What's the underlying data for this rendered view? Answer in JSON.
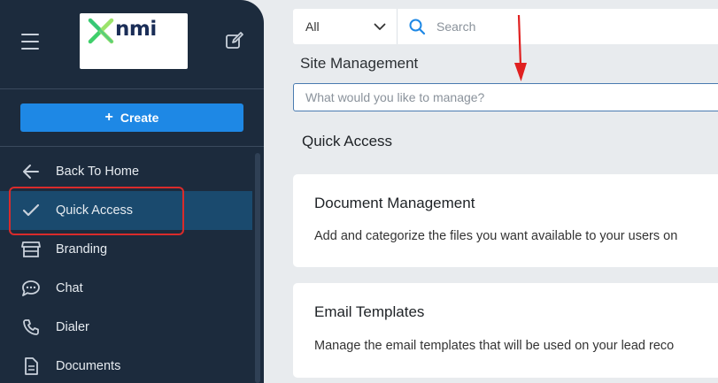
{
  "sidebar": {
    "logo_text": "nmi",
    "create_label": "Create",
    "nav": [
      {
        "label": "Back To Home",
        "icon": "arrow-left-icon"
      },
      {
        "label": "Quick Access",
        "icon": "check-icon",
        "active": true
      },
      {
        "label": "Branding",
        "icon": "storefront-icon"
      },
      {
        "label": "Chat",
        "icon": "chat-bubble-icon"
      },
      {
        "label": "Dialer",
        "icon": "phone-icon"
      },
      {
        "label": "Documents",
        "icon": "document-icon"
      }
    ]
  },
  "topbar": {
    "filter_value": "All",
    "search_placeholder": "Search"
  },
  "main": {
    "section_title": "Site Management",
    "manage_placeholder": "What would you like to manage?",
    "quick_access_title": "Quick Access",
    "cards": [
      {
        "title": "Document Management",
        "description": "Add and categorize the files you want available to your users on"
      },
      {
        "title": "Email Templates",
        "description": "Manage the email templates that will be used on your lead reco"
      }
    ]
  },
  "colors": {
    "sidebar_bg": "#1c2b3d",
    "accent": "#1e88e5",
    "active_item": "#1a4a6e",
    "annotation_red": "#d92b2b",
    "logo_green": "#3fcf6a"
  }
}
